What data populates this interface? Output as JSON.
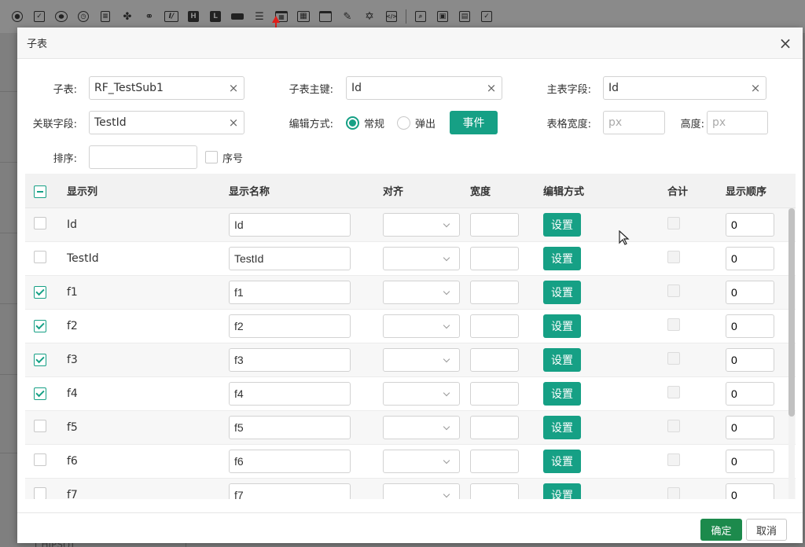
{
  "toolbar_icons": [
    "radio-icon",
    "checkbox-icon",
    "radio-filled-icon",
    "clock-icon",
    "form-icon",
    "grid-dots-icon",
    "link-icon",
    "italic-box-icon",
    "h-icon",
    "l-icon",
    "rect-icon",
    "list-icon",
    "subtable-icon",
    "grid-icon",
    "window-icon",
    "pen-icon",
    "star-icon",
    "code-icon",
    "preview-icon",
    "save-icon",
    "save-as-icon",
    "check-doc-icon"
  ],
  "dialog": {
    "title": "子表",
    "close_glyph": "×"
  },
  "form": {
    "subtable_label": "子表:",
    "subtable_value": "RF_TestSub1",
    "subkey_label": "子表主键:",
    "subkey_value": "Id",
    "mainfield_label": "主表字段:",
    "mainfield_value": "Id",
    "relfield_label": "关联字段:",
    "relfield_value": "TestId",
    "editmode_label": "编辑方式:",
    "editmode_options": [
      "常规",
      "弹出"
    ],
    "editmode_selected": "常规",
    "event_button": "事件",
    "tablewidth_label": "表格宽度:",
    "tablewidth_placeholder": "px",
    "height_label": "高度:",
    "height_placeholder": "px",
    "sort_label": "排序:",
    "sort_value": "",
    "serial_label": "序号",
    "clear_glyph": "×"
  },
  "table": {
    "headers": [
      "显示列",
      "显示名称",
      "对齐",
      "宽度",
      "编辑方式",
      "合计",
      "显示顺序"
    ],
    "set_button": "设置",
    "rows": [
      {
        "column": "Id",
        "display": "Id",
        "checked": false,
        "order": "0"
      },
      {
        "column": "TestId",
        "display": "TestId",
        "checked": false,
        "order": "0"
      },
      {
        "column": "f1",
        "display": "f1",
        "checked": true,
        "order": "0"
      },
      {
        "column": "f2",
        "display": "f2",
        "checked": true,
        "order": "0"
      },
      {
        "column": "f3",
        "display": "f3",
        "checked": true,
        "order": "0"
      },
      {
        "column": "f4",
        "display": "f4",
        "checked": true,
        "order": "0"
      },
      {
        "column": "f5",
        "display": "f5",
        "checked": false,
        "order": "0"
      },
      {
        "column": "f6",
        "display": "f6",
        "checked": false,
        "order": "0"
      },
      {
        "column": "f7",
        "display": "f7",
        "checked": false,
        "order": "0"
      }
    ]
  },
  "footer": {
    "ok_label": "确定",
    "cancel_label": "取消"
  },
  "background": {
    "bottom_text": "[ HIPS()]"
  },
  "colors": {
    "accent": "#16a085",
    "ok_button": "#1c8a4c",
    "annotation_arrow": "#e0201b"
  }
}
